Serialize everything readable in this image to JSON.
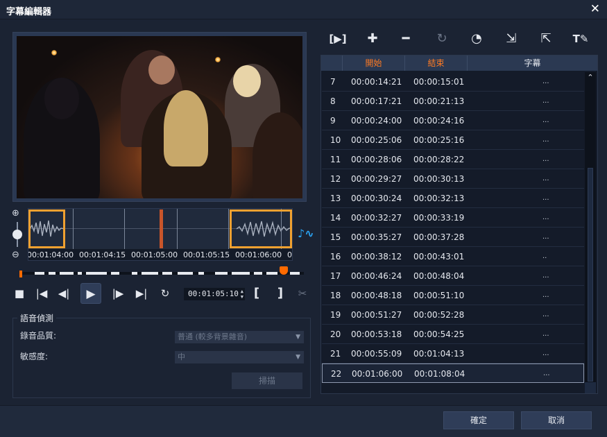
{
  "window": {
    "title": "字幕編輯器",
    "close_glyph": "✕"
  },
  "toolbar": {
    "tools": [
      {
        "name": "play-subtitle-icon",
        "glyph": "[▶]"
      },
      {
        "name": "add-icon",
        "glyph": "✚"
      },
      {
        "name": "remove-icon",
        "glyph": "━"
      },
      {
        "name": "merge-icon",
        "glyph": "↻"
      },
      {
        "name": "timecode-icon",
        "glyph": "◔"
      },
      {
        "name": "import-icon",
        "glyph": "⇲"
      },
      {
        "name": "export-icon",
        "glyph": "⇱"
      },
      {
        "name": "text-edit-icon",
        "glyph": "T✎"
      }
    ]
  },
  "timeline": {
    "ticks": [
      "00:01:04:00",
      "00:01:04:15",
      "00:01:05:00",
      "00:01:05:15",
      "00:01:06:00",
      "0"
    ],
    "timecode": "00:01:05:10",
    "playhead_fraction": 0.93
  },
  "transport": {
    "stop": "■",
    "prev": "|◀",
    "step_back": "◀|",
    "play": "▶",
    "step_fwd": "|▶",
    "next": "▶|",
    "loop": "↻",
    "mark_in": "[",
    "mark_out": "]",
    "cut": "✂"
  },
  "voice_detection": {
    "legend": "語音偵測",
    "quality_label": "錄音品質:",
    "quality_value": "普通 (較多背景雜音)",
    "sensitivity_label": "敏感度:",
    "sensitivity_value": "中",
    "scan_label": "掃描"
  },
  "grid": {
    "columns": [
      "",
      "開始",
      "結束",
      "字幕"
    ],
    "rows": [
      {
        "n": "7",
        "start": "00:00:14:21",
        "end": "00:00:15:01",
        "sub": "..."
      },
      {
        "n": "8",
        "start": "00:00:17:21",
        "end": "00:00:21:13",
        "sub": "..."
      },
      {
        "n": "9",
        "start": "00:00:24:00",
        "end": "00:00:24:16",
        "sub": "..."
      },
      {
        "n": "10",
        "start": "00:00:25:06",
        "end": "00:00:25:16",
        "sub": "..."
      },
      {
        "n": "11",
        "start": "00:00:28:06",
        "end": "00:00:28:22",
        "sub": "..."
      },
      {
        "n": "12",
        "start": "00:00:29:27",
        "end": "00:00:30:13",
        "sub": "..."
      },
      {
        "n": "13",
        "start": "00:00:30:24",
        "end": "00:00:32:13",
        "sub": "..."
      },
      {
        "n": "14",
        "start": "00:00:32:27",
        "end": "00:00:33:19",
        "sub": "..."
      },
      {
        "n": "15",
        "start": "00:00:35:27",
        "end": "00:00:37:28",
        "sub": "..."
      },
      {
        "n": "16",
        "start": "00:00:38:12",
        "end": "00:00:43:01",
        "sub": ".."
      },
      {
        "n": "17",
        "start": "00:00:46:24",
        "end": "00:00:48:04",
        "sub": "..."
      },
      {
        "n": "18",
        "start": "00:00:48:18",
        "end": "00:00:51:10",
        "sub": "..."
      },
      {
        "n": "19",
        "start": "00:00:51:27",
        "end": "00:00:52:28",
        "sub": "..."
      },
      {
        "n": "20",
        "start": "00:00:53:18",
        "end": "00:00:54:25",
        "sub": "..."
      },
      {
        "n": "21",
        "start": "00:00:55:09",
        "end": "00:01:04:13",
        "sub": "..."
      },
      {
        "n": "22",
        "start": "00:01:06:00",
        "end": "00:01:08:04",
        "sub": "..."
      }
    ],
    "selected_row": "22"
  },
  "footer": {
    "ok": "確定",
    "cancel": "取消"
  },
  "colors": {
    "accent": "#ff7b24",
    "selection": "#f0a130",
    "wave_icon": "#2aa4f4"
  }
}
